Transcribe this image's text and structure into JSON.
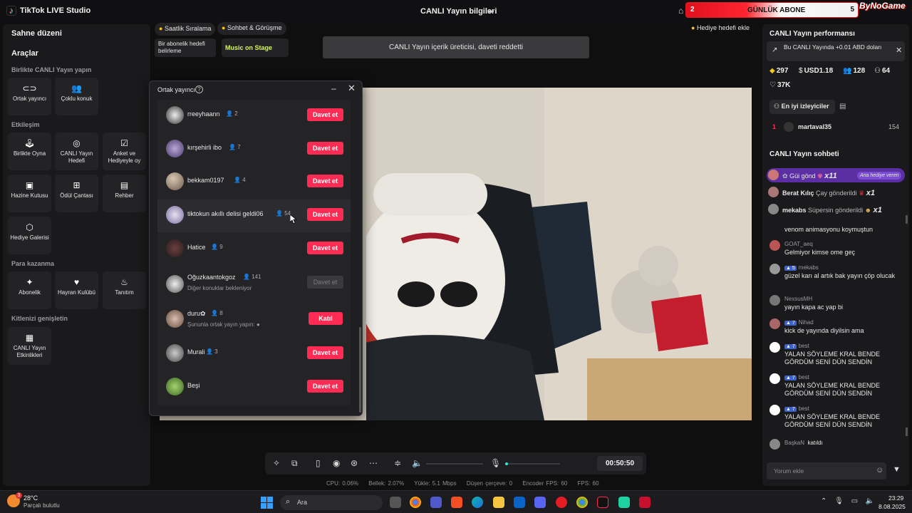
{
  "titlebar": {
    "app_title": "TikTok LIVE Studio",
    "live_info": "CANLI Yayın bilgileri",
    "goal": {
      "left_count": "2",
      "label": "GÜNLÜK ABONE",
      "right_count": "5",
      "progress_fraction": 0.45
    },
    "brand": "ByNoGame"
  },
  "left_panel": {
    "stage_layout": "Sahne düzeni",
    "tools_title": "Araçlar",
    "sections": {
      "live_together": "Birlikte CANLI Yayın yapın",
      "interaction": "Etkileşim",
      "earn": "Para kazanma",
      "expand": "Kitlenizi genişletin"
    },
    "tools": {
      "cohost": "Ortak yayıncı",
      "multi_guest": "Çoklu konuk",
      "play_together": "Birlikte Oyna",
      "live_goal": "CANLI Yayın Hedefi",
      "poll": "Anket ve Hediyeyle oy",
      "treasure": "Hazine Kutusu",
      "reward_bag": "Ödül Çantası",
      "guide": "Rehber",
      "gift_gallery": "Hediye Galerisi",
      "subscription": "Abonelik",
      "fan_club": "Hayran Kulübü",
      "promotion": "Tanıtım",
      "live_events": "CANLI Yayın Etkinlikleri"
    }
  },
  "top_chips": {
    "hourly_ranking": "Saatlik Sıralama",
    "chat_meet": "Sohbet & Görüşme",
    "sub_goal": "Bir abonelik hedefi belirleme",
    "music_on_stage": "Music on Stage",
    "rejected": "CANLI Yayın içerik üreticisi, daveti reddetti",
    "add_gift_goal": "Hediye hedefi ekle"
  },
  "cohost_dialog": {
    "title": "Ortak yayıncı",
    "rows": [
      {
        "name": "rreeyhaann",
        "count": "2",
        "sub": "",
        "action": "Davet et",
        "state": "active"
      },
      {
        "name": "kırşehirli ibo",
        "count": "7",
        "sub": "",
        "action": "Davet et",
        "state": "active"
      },
      {
        "name": "bekkam0197",
        "count": "4",
        "sub": "",
        "action": "Davet et",
        "state": "active"
      },
      {
        "name": "tiktokun akıllı delisi geldi06",
        "count": "54",
        "sub": "",
        "action": "Davet et",
        "state": "active"
      },
      {
        "name": "Hatice",
        "count": "9",
        "sub": "",
        "action": "Davet et",
        "state": "active"
      },
      {
        "name": "Oğuzkaantokgoz",
        "count": "141",
        "sub": "Diğer konuklar bekleniyor",
        "action": "Davet et",
        "state": "disabled"
      },
      {
        "name": "duru✿",
        "count": "8",
        "sub": "Şununla ortak yayın yapın:",
        "action": "Katıl",
        "state": "join"
      },
      {
        "name": "Murali",
        "count": "3",
        "sub": "",
        "action": "Davet et",
        "state": "active"
      },
      {
        "name": "Beşi",
        "count": "",
        "sub": "",
        "action": "Davet et",
        "state": "active"
      }
    ]
  },
  "bottom_bar": {
    "timer": "00:50:50",
    "volume_level": 0.0,
    "mic_level": 0.05
  },
  "stats": {
    "cpu": "CPU:  0.06%",
    "memory": "Bellek:  2.07%",
    "upload": "Yükle:  5.1 Mbps",
    "dropped": "Düşen çerçeve:  0",
    "encoder_fps": "Encoder FPS:  60",
    "fps": "FPS:  60"
  },
  "right_panel": {
    "perf_title": "CANLI Yayın performansı",
    "perf_note": "Bu CANLI Yayında +0.01 ABD doları",
    "stats": {
      "diamonds": "297",
      "usd": "USD1.18",
      "viewers": "128",
      "gifters": "64",
      "likes": "37K"
    },
    "top_viewers_tab": "En iyi izleyiciler",
    "top_viewer": {
      "rank": "1",
      "name": "martaval35",
      "score": "154"
    },
    "chat_title": "CANLI Yayın sohbeti",
    "gifts": [
      {
        "name": "",
        "text": "Güi gönd",
        "mult": "x11",
        "badge": "Ana hediye veren"
      },
      {
        "name": "Berat Kılıç",
        "text": "Çay gönderildi",
        "mult": "x1",
        "badge": ""
      },
      {
        "name": "mekabs",
        "text": "Süpersin gönderildi",
        "mult": "x1",
        "badge": ""
      }
    ],
    "messages": [
      {
        "name": "",
        "level": "",
        "text": "venom animasyonu koymuştun"
      },
      {
        "name": "GOAT_aeq",
        "level": "",
        "text": "Gelmiyor kimse ome geç"
      },
      {
        "name": "mekabs",
        "level": "5",
        "text": "güzel karı al artık bak yayın çöp olucak"
      },
      {
        "name": "NexsusMH",
        "level": "",
        "text": "yayın kapa ac yap bi"
      },
      {
        "name": "Nihad",
        "level": "7",
        "text": "kick de yayında diyilsin ama"
      },
      {
        "name": "best",
        "level": "7",
        "text": "YALAN SÖYLEME KRAL BENDE GÖRDÜM SENİ DÜN SENDİN"
      },
      {
        "name": "best",
        "level": "7",
        "text": "YALAN SÖYLEME KRAL BENDE GÖRDÜM SENİ DÜN SENDİN"
      },
      {
        "name": "best",
        "level": "7",
        "text": "YALAN SÖYLEME KRAL BENDE GÖRDÜM SENİ DÜN SENDİN"
      },
      {
        "name": "BaşkaN",
        "level": "",
        "text": "katıldı"
      }
    ],
    "comment_placeholder": "Yorum ekle"
  },
  "taskbar": {
    "weather_temp": "28°C",
    "weather_desc": "Parçalı bulutlu",
    "weather_badge": "3",
    "search_placeholder": "Ara",
    "time": "23:29",
    "date": "8.08.2025"
  },
  "colors": {
    "accent": "#fe2c55",
    "panel": "#1a1a1c",
    "background": "#0f0f10"
  }
}
